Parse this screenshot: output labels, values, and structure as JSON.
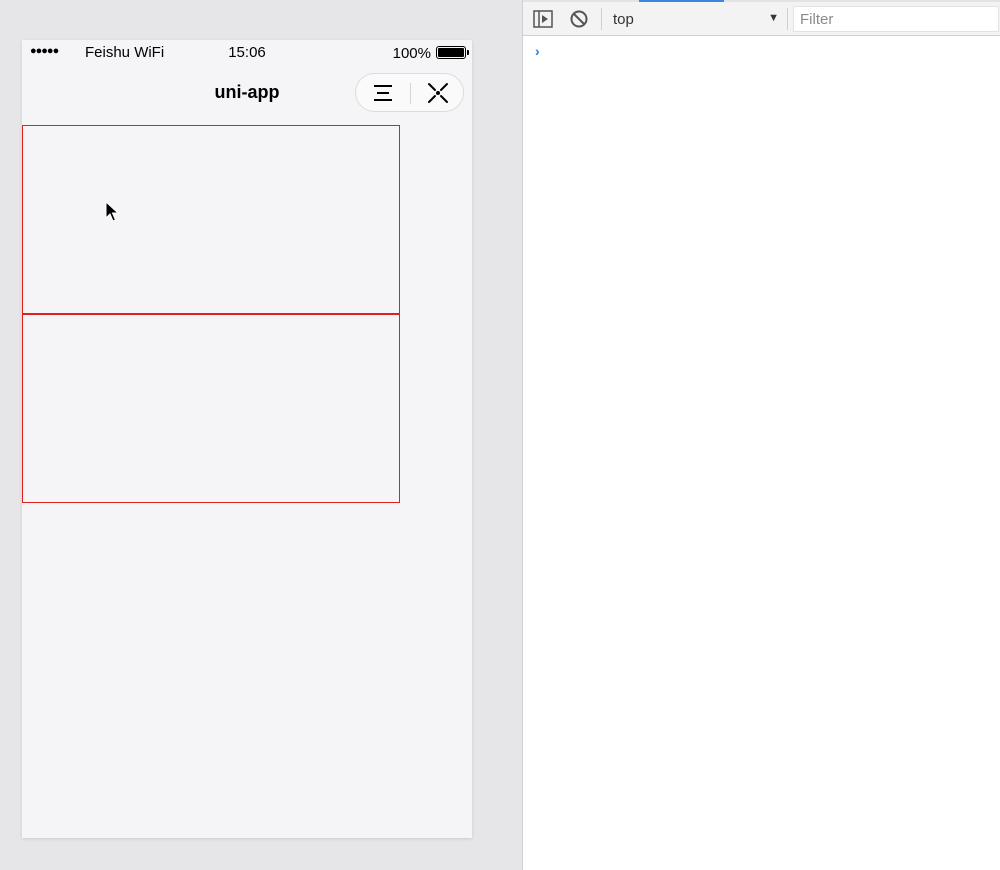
{
  "status_bar": {
    "signal": "●●●●●",
    "carrier": "Feishu WiFi",
    "time": "15:06",
    "battery": "100%"
  },
  "nav": {
    "title": "uni-app",
    "menu_icon": "menu-icon",
    "close_icon": "close-icon"
  },
  "colors": {
    "box_border": "#e02020",
    "page_bg": "#f5f4f7",
    "accent": "#3a86e0"
  },
  "devtools": {
    "context": "top",
    "filter_placeholder": "Filter",
    "prompt": "›"
  }
}
